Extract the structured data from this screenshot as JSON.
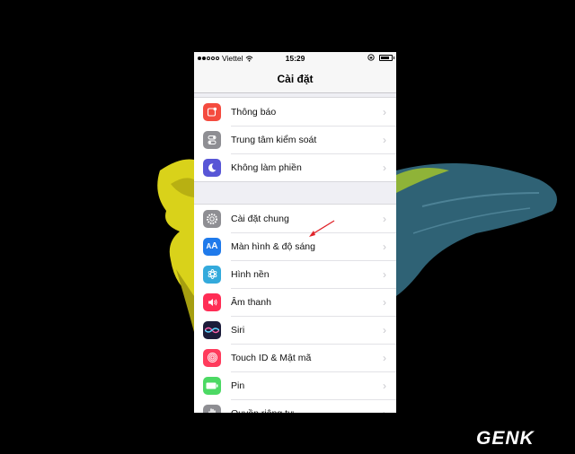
{
  "status_bar": {
    "carrier": "Viettel",
    "time": "15:29",
    "signal": "signal-dots-icon",
    "wifi": "wifi-icon",
    "rotation_lock": "rotation-lock-icon",
    "battery": "battery-icon"
  },
  "nav": {
    "title": "Cài đặt"
  },
  "groups": [
    {
      "items": [
        {
          "label": "Thông báo",
          "icon": "notifications-icon",
          "color": "#f44b3f"
        },
        {
          "label": "Trung tâm kiểm soát",
          "icon": "control-center-icon",
          "color": "#8e8e93"
        },
        {
          "label": "Không làm phiền",
          "icon": "moon-icon",
          "color": "#5856d6"
        }
      ]
    },
    {
      "items": [
        {
          "label": "Cài đặt chung",
          "icon": "gear-icon",
          "color": "#8e8e93"
        },
        {
          "label": "Màn hình & độ sáng",
          "icon": "display-brightness-icon",
          "color": "#1f7aeb"
        },
        {
          "label": "Hình nền",
          "icon": "wallpaper-icon",
          "color": "#34aadc"
        },
        {
          "label": "Âm thanh",
          "icon": "speaker-icon",
          "color": "#ff2d55"
        },
        {
          "label": "Siri",
          "icon": "siri-icon",
          "color": "#1c1c3a"
        },
        {
          "label": "Touch ID & Mật mã",
          "icon": "fingerprint-icon",
          "color": "#ff3b5c"
        },
        {
          "label": "Pin",
          "icon": "battery-icon",
          "color": "#4cd964"
        },
        {
          "label": "Quyền riêng tư",
          "icon": "hand-icon",
          "color": "#8e8e93"
        }
      ]
    }
  ],
  "chevron": "›",
  "watermark": "GENK"
}
